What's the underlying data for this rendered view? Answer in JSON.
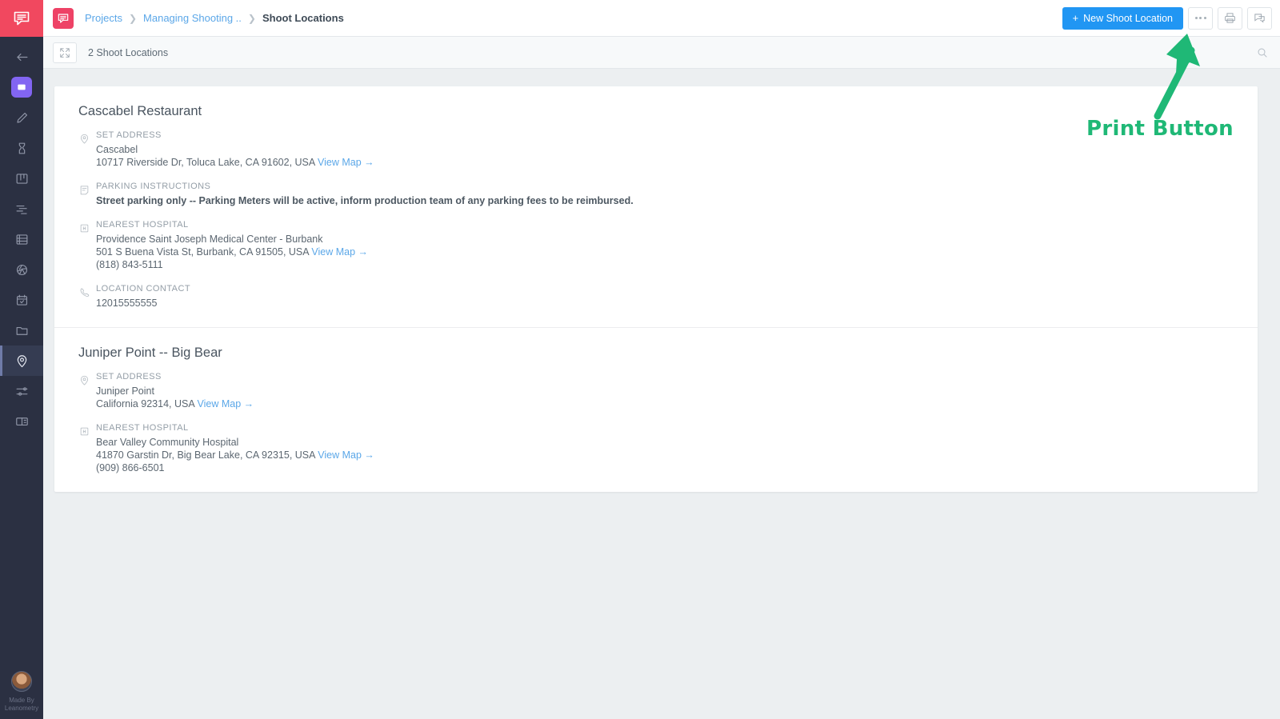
{
  "colors": {
    "rail_bg": "#2b3042",
    "brand_pink": "#f1485f",
    "accent_blue": "#2196f3",
    "link_blue": "#5ba7e8",
    "annotation_green": "#1fb876",
    "page_bg": "#eceff1",
    "active_nav_purple": "#8265f2"
  },
  "rail": {
    "logo_icon": "speech-bubble-logo-icon",
    "items": [
      {
        "icon": "back-arrow-icon",
        "name": "collapse-nav"
      },
      {
        "icon": "dashboard-icon",
        "name": "dashboard",
        "style": "active-box"
      },
      {
        "icon": "pencil-icon",
        "name": "script"
      },
      {
        "icon": "people-icon",
        "name": "cast-crew"
      },
      {
        "icon": "board-icon",
        "name": "storyboard"
      },
      {
        "icon": "schedule-icon",
        "name": "schedule"
      },
      {
        "icon": "list-icon",
        "name": "breakdown"
      },
      {
        "icon": "aperture-icon",
        "name": "shots"
      },
      {
        "icon": "calendar-check-icon",
        "name": "calendar"
      },
      {
        "icon": "folder-icon",
        "name": "files"
      },
      {
        "icon": "map-pin-icon",
        "name": "shoot-locations",
        "selected": true
      },
      {
        "icon": "sliders-icon",
        "name": "settings"
      },
      {
        "icon": "book-icon",
        "name": "reports"
      }
    ],
    "made_by_line1": "Made By",
    "made_by_line2": "Leanometry",
    "avatar_name": "user-avatar"
  },
  "header": {
    "project_logo_icon": "speech-bubble-icon",
    "breadcrumbs": [
      {
        "label": "Projects",
        "current": false
      },
      {
        "label": "Managing Shooting ..",
        "current": false
      },
      {
        "label": "Shoot Locations",
        "current": true
      }
    ],
    "new_button_label": "New Shoot Location",
    "new_button_plus": "+",
    "more_button_icon": "ellipsis-icon",
    "print_button_icon": "printer-icon",
    "comments_button_icon": "chat-bubble-icon"
  },
  "subheader": {
    "expand_icon": "expand-collapse-icon",
    "title": "2 Shoot Locations",
    "search_icon": "search-icon"
  },
  "annotation": {
    "label": "Print Button",
    "arrow_icon": "green-arrow-icon",
    "points_to": "print-button"
  },
  "locations": [
    {
      "title": "Cascabel Restaurant",
      "fields": [
        {
          "icon": "map-pin-icon",
          "label": "SET ADDRESS",
          "lines": [
            {
              "text": "Cascabel",
              "bold": false,
              "link": null
            },
            {
              "text": "10717 Riverside Dr, Toluca Lake, CA 91602, USA",
              "bold": false,
              "link": "View Map →"
            }
          ]
        },
        {
          "icon": "note-icon",
          "label": "PARKING INSTRUCTIONS",
          "lines": [
            {
              "text": "Street parking only -- Parking Meters will be active, inform production team of any parking fees to be reimbursed.",
              "bold": true,
              "link": null
            }
          ]
        },
        {
          "icon": "hospital-icon",
          "label": "NEAREST HOSPITAL",
          "lines": [
            {
              "text": "Providence Saint Joseph Medical Center - Burbank",
              "bold": false,
              "link": null
            },
            {
              "text": "501 S Buena Vista St, Burbank, CA 91505, USA",
              "bold": false,
              "link": "View Map →"
            },
            {
              "text": "(818) 843-5111",
              "bold": false,
              "link": null
            }
          ]
        },
        {
          "icon": "phone-icon",
          "label": "LOCATION CONTACT",
          "lines": [
            {
              "text": "12015555555",
              "bold": false,
              "link": null
            }
          ]
        }
      ]
    },
    {
      "title": "Juniper Point -- Big Bear",
      "fields": [
        {
          "icon": "map-pin-icon",
          "label": "SET ADDRESS",
          "lines": [
            {
              "text": "Juniper Point",
              "bold": false,
              "link": null
            },
            {
              "text": "California 92314, USA",
              "bold": false,
              "link": "View Map →"
            }
          ]
        },
        {
          "icon": "hospital-icon",
          "label": "NEAREST HOSPITAL",
          "lines": [
            {
              "text": "Bear Valley Community Hospital",
              "bold": false,
              "link": null
            },
            {
              "text": "41870 Garstin Dr, Big Bear Lake, CA 92315, USA",
              "bold": false,
              "link": "View Map →"
            },
            {
              "text": "(909) 866-6501",
              "bold": false,
              "link": null
            }
          ]
        }
      ]
    }
  ]
}
